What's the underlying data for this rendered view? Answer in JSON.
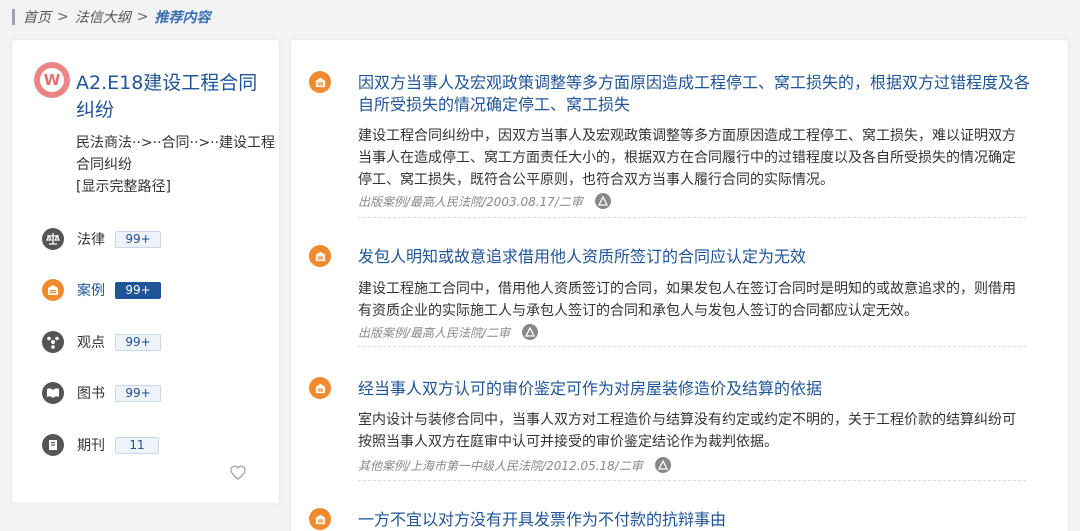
{
  "breadcrumb": {
    "home": "首页",
    "section": "法信大纲",
    "current": "推荐内容",
    "separator": ">"
  },
  "topic": {
    "logo_letter": "W",
    "title": "A2.E18建设工程合同纠纷",
    "path": "民法商法··>··合同··>··建设工程合同纠纷",
    "show_full": "[显示完整路径]"
  },
  "categories": [
    {
      "label": "法律",
      "count": "99+",
      "icon": "scale-icon",
      "active": false
    },
    {
      "label": "案例",
      "count": "99+",
      "icon": "case-icon",
      "active": true
    },
    {
      "label": "观点",
      "count": "99+",
      "icon": "viewpoint-icon",
      "active": false
    },
    {
      "label": "图书",
      "count": "99+",
      "icon": "book-icon",
      "active": false
    },
    {
      "label": "期刊",
      "count": "11",
      "icon": "journal-icon",
      "active": false
    }
  ],
  "favorite_icon": "heart-icon",
  "cases": [
    {
      "title": "因双方当事人及宏观政策调整等多方面原因造成工程停工、窝工损失的，根据双方过错程度及各自所受损失的情况确定停工、窝工损失",
      "body": "建设工程合同纠纷中，因双方当事人及宏观政策调整等多方面原因造成工程停工、窝工损失，难以证明双方当事人在造成停工、窝工方面责任大小的，根据双方在合同履行中的过错程度以及各自所受损失的情况确定停工、窝工损失，既符合公平原则，也符合双方当事人履行合同的实际情况。",
      "meta": "出版案例/最高人民法院/2003.08.17/二审"
    },
    {
      "title": "发包人明知或故意追求借用他人资质所签订的合同应认定为无效",
      "body": "建设工程施工合同中，借用他人资质签订的合同，如果发包人在签订合同时是明知的或故意追求的，则借用有资质企业的实际施工人与承包人签订的合同和承包人与发包人签订的合同都应认定无效。",
      "meta": "出版案例/最高人民法院/二审"
    },
    {
      "title": "经当事人双方认可的审价鉴定可作为对房屋装修造价及结算的依据",
      "body": "室内设计与装修合同中，当事人双方对工程造价与结算没有约定或约定不明的，关于工程价款的结算纠纷可按照当事人双方在庭审中认可并接受的审价鉴定结论作为裁判依据。",
      "meta": "其他案例/上海市第一中级人民法院/2012.05.18/二审"
    },
    {
      "title": "一方不宜以对方没有开具发票作为不付款的抗辩事由",
      "body": "",
      "meta": ""
    }
  ]
}
